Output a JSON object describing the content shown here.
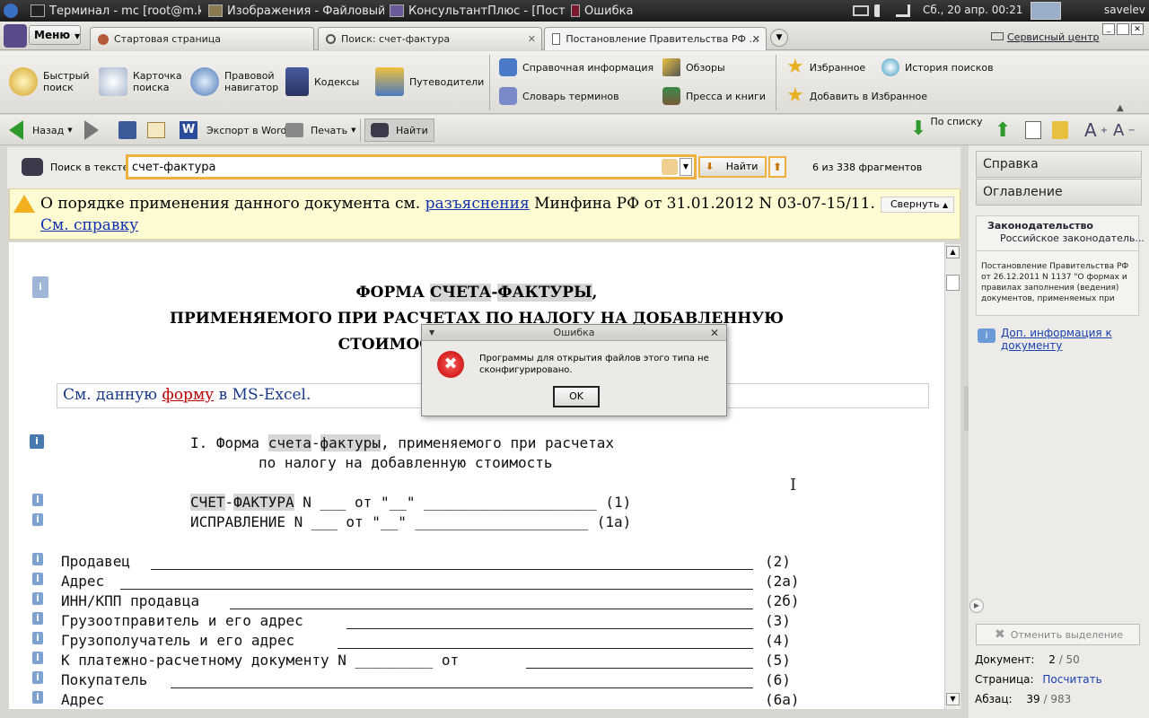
{
  "taskbar": {
    "tasks": [
      "Терминал - mc [root@m.k...",
      "Изображения - Файловый...",
      "КонсультантПлюс - [Поста...",
      "Ошибка"
    ],
    "clock": "Сб., 20 апр.  00:21",
    "user": "savelev"
  },
  "menu": {
    "label": "Меню"
  },
  "tabs": [
    "Стартовая страница",
    "Поиск: счет-фактура",
    "Постановление Правительства РФ ..."
  ],
  "service_center": "Сервисный центр",
  "ribbon": {
    "quick_search": "Быстрый\nпоиск",
    "search_card": "Карточка\nпоиска",
    "legal_nav": "Правовой\nнавигатор",
    "codes": "Кодексы",
    "guides": "Путеводители",
    "reference": "Справочная информация",
    "glossary": "Словарь терминов",
    "reviews": "Обзоры",
    "press": "Пресса и книги",
    "favorites": "Избранное",
    "add_favorites": "Добавить в Избранное",
    "history": "История поисков"
  },
  "toolbar": {
    "back": "Назад",
    "export_word": "Экспорт в Word",
    "print": "Печать",
    "find": "Найти",
    "by_list": "По списку"
  },
  "search": {
    "label": "Поиск в тексте",
    "value": "счет-фактура",
    "find_btn": "Найти",
    "fragments": "6 из 338 фрагментов"
  },
  "notice": {
    "text_pre": "О порядке применения данного документа см. ",
    "link": "разъяснения",
    "text_post": " Минфина РФ от 31.01.2012 N 03-07-15/11.",
    "see_ref": "См. справку",
    "collapse": "Свернуть"
  },
  "document": {
    "title_l1_a": "ФОРМА ",
    "title_l1_hl1": "СЧЕТА",
    "title_l1_b": "-",
    "title_l1_hl2": "ФАКТУРЫ",
    "title_l1_c": ",",
    "title_l2": "ПРИМЕНЯЕМОГО ПРИ РАСЧЕТАХ ПО НАЛОГУ НА ДОБАВЛЕННУЮ",
    "title_l3": "СТОИМОСТЬ, И",
    "excel_pre": "См. данную ",
    "excel_link": "форму",
    "excel_post": " в MS-Excel.",
    "sec_a": "I. Форма ",
    "sec_hl1": "счета",
    "sec_b": "-",
    "sec_hl2": "фактуры",
    "sec_c": ", применяемого при расчетах",
    "sec_l2": "по налогу на добавленную стоимость",
    "invoice_hl1": "СЧЕТ",
    "invoice_b": "-",
    "invoice_hl2": "ФАКТУРА",
    "invoice_c": " N ___ от \"__\" ____________________ (1)",
    "correction": "ИСПРАВЛЕНИЕ N ___ от \"__\" ____________________ (1а)",
    "fields": [
      {
        "label": "Продавец",
        "code": "(2)"
      },
      {
        "label": "Адрес",
        "code": "(2а)"
      },
      {
        "label": "ИНН/КПП продавца",
        "code": "(2б)"
      },
      {
        "label": "Грузоотправитель и его адрес",
        "code": "(3)"
      },
      {
        "label": "Грузополучатель и его адрес",
        "code": "(4)"
      },
      {
        "label": "К платежно-расчетному документу N _________ от",
        "code": "(5)"
      },
      {
        "label": "Покупатель",
        "code": "(6)"
      },
      {
        "label": "Адрес",
        "code": "(6а)"
      }
    ]
  },
  "right_panel": {
    "help": "Справка",
    "contents": "Оглавление",
    "legislation": "Законодательство",
    "legislation_sub": "Российское законодатель...",
    "doc_desc": "Постановление Правительства РФ от 26.12.2011 N 1137 \"О формах и правилах заполнения (ведения) документов, применяемых при",
    "extra_info": "Доп. информация к документу",
    "clear_sel": "Отменить выделение",
    "doc_label": "Документ:",
    "doc_value": "2",
    "doc_total": "/ 50",
    "page_label": "Страница:",
    "page_value": "Посчитать",
    "para_label": "Абзац:",
    "para_value": "39",
    "para_total": "/ 983"
  },
  "dialog": {
    "title": "Ошибка",
    "message": "Программы для открытия файлов этого типа не сконфигурировано.",
    "ok": "OK"
  }
}
